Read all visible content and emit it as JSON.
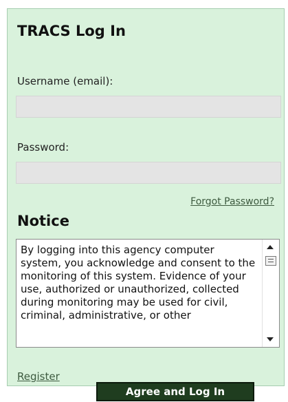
{
  "login": {
    "title": "TRACS Log In",
    "username_label": "Username (email):",
    "username_value": "",
    "password_label": "Password:",
    "password_value": "",
    "forgot_password": "Forgot Password?"
  },
  "notice": {
    "title": "Notice",
    "text": "By logging into this agency computer system, you acknowledge and consent to the monitoring of this system. Evidence of your use, authorized or unauthorized, collected during monitoring may be used for civil, criminal, administrative, or other"
  },
  "footer": {
    "register": "Register",
    "submit": "Agree and Log In"
  },
  "colors": {
    "panel_bg": "#d9f2dc",
    "button_bg": "#1f3d1f",
    "link": "#3d5a3f"
  }
}
